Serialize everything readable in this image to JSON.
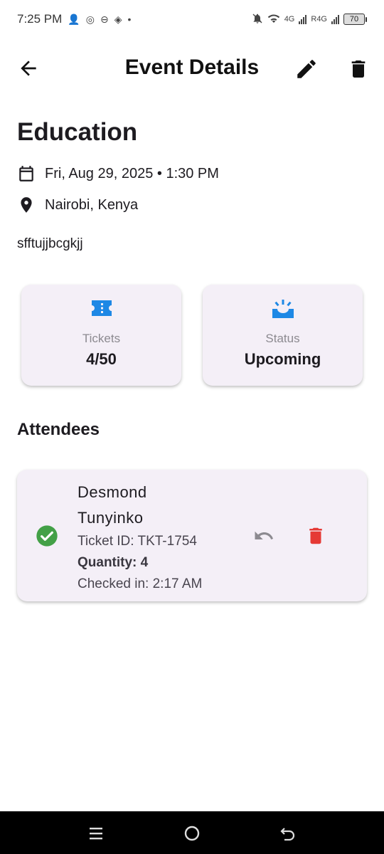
{
  "status_bar": {
    "time": "7:25 PM",
    "icons": [
      "person-icon",
      "whatsapp-icon",
      "sync-icon",
      "binance-icon",
      "dot-icon"
    ],
    "net1": "4G",
    "net2": "R4G",
    "battery": "70"
  },
  "app_bar": {
    "title": "Event Details",
    "back_icon": "arrow-back-icon",
    "edit_icon": "edit-icon",
    "delete_icon": "delete-icon"
  },
  "event": {
    "title": "Education",
    "datetime": "Fri, Aug 29, 2025 • 1:30 PM",
    "location": "Nairobi, Kenya",
    "description": "sfftujjbcgkjj"
  },
  "stats": {
    "tickets_label": "Tickets",
    "tickets_value": "4/50",
    "status_label": "Status",
    "status_value": "Upcoming"
  },
  "attendees": {
    "section_title": "Attendees",
    "items": [
      {
        "name_first": "Desmond",
        "name_last": "Tunyinko",
        "ticket_id": "Ticket ID: TKT-1754",
        "quantity": "Quantity: 4",
        "checked_in": "Checked in: 2:17 AM"
      }
    ]
  },
  "colors": {
    "accent_blue": "#1e88e5",
    "success_green": "#43a047",
    "danger_red": "#e53935",
    "card_bg": "#f4eff7"
  }
}
